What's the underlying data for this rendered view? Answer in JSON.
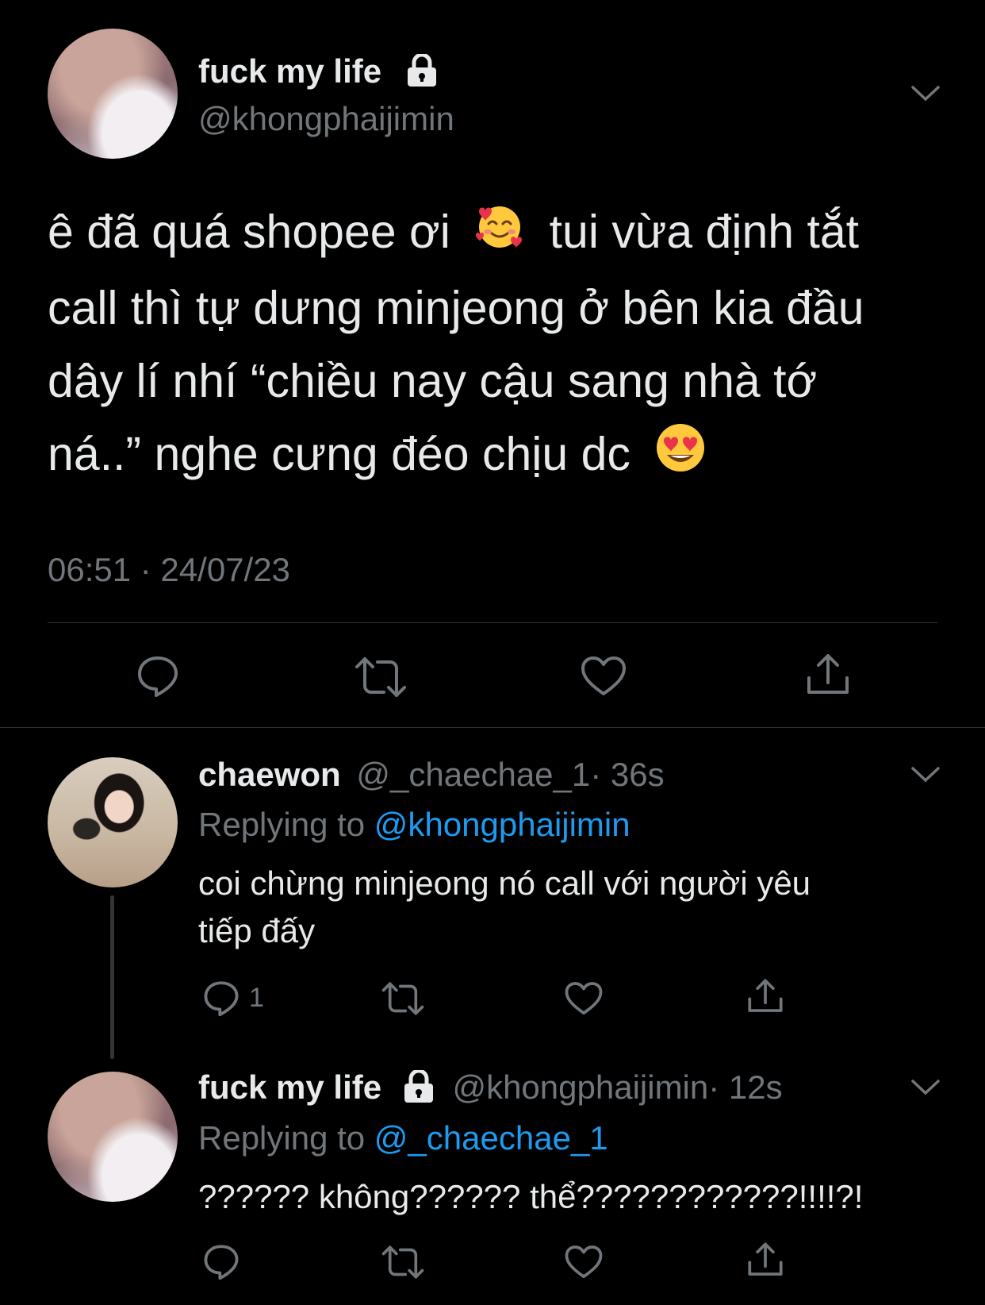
{
  "main_tweet": {
    "display_name": "fuck my life",
    "handle": "@khongphaijimin",
    "lines": [
      "ê đã quá shopee ơi",
      "tui vừa định tắt",
      "call thì tự dưng minjeong ở bên kia đầu",
      "dây lí nhí “chiều nay cậu sang nhà tớ",
      "ná..” nghe cưng đéo chịu dc"
    ],
    "timestamp": "06:51 · 24/07/23",
    "emoji_1": "smiling-face-with-hearts",
    "emoji_2": "heart-eyes"
  },
  "reply_1": {
    "display_name": "chaewon",
    "handle": "@_chaechae_1",
    "time": "· 36s",
    "replying_prefix": "Replying to",
    "replying_to": "@khongphaijimin",
    "text_line_1": "coi chừng minjeong nó call với người yêu",
    "text_line_2": "tiếp đấy",
    "reply_count": "1"
  },
  "reply_2": {
    "display_name": "fuck my life",
    "handle": "@khongphaijimin",
    "time": "· 12s",
    "replying_prefix": "Replying to",
    "replying_to": "@_chaechae_1",
    "text": "?????? không?????? thể????????????!!!!?!"
  },
  "colors": {
    "background": "#000000",
    "text": "#e7e9ea",
    "secondary": "#71767b",
    "link": "#1d9bf0",
    "divider": "#2f3336"
  }
}
